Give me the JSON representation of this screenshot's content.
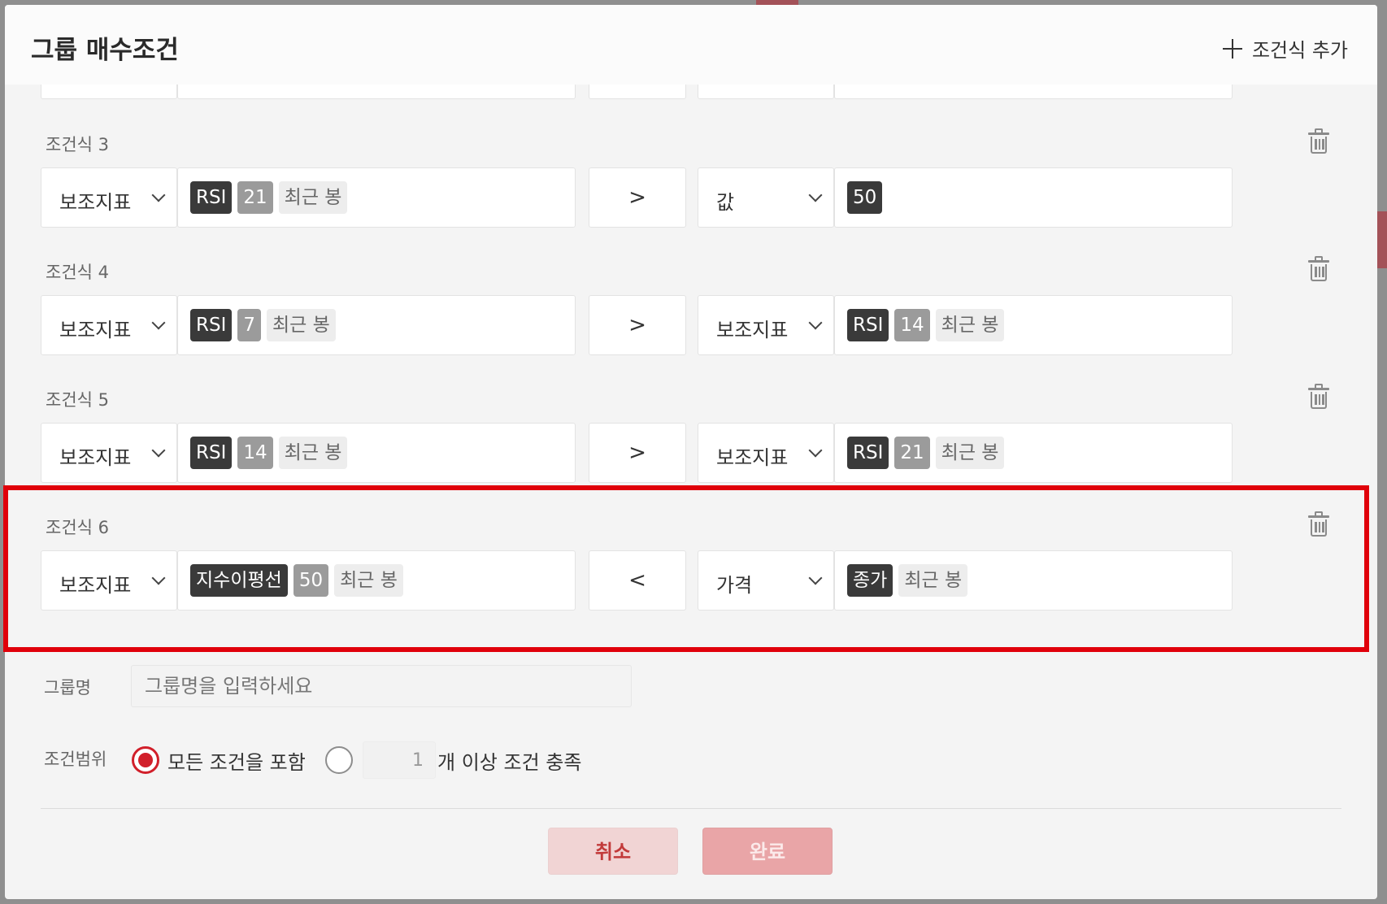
{
  "header": {
    "title": "그룹 매수조건",
    "add_condition_label": "조건식 추가"
  },
  "conditions": [
    {
      "label": "조건식 3",
      "left_type": "보조지표",
      "left_tags": [
        "RSI",
        "21",
        "최근 봉"
      ],
      "operator": ">",
      "right_type": "값",
      "right_tags": [
        "50"
      ]
    },
    {
      "label": "조건식 4",
      "left_type": "보조지표",
      "left_tags": [
        "RSI",
        "7",
        "최근 봉"
      ],
      "operator": ">",
      "right_type": "보조지표",
      "right_tags": [
        "RSI",
        "14",
        "최근 봉"
      ]
    },
    {
      "label": "조건식 5",
      "left_type": "보조지표",
      "left_tags": [
        "RSI",
        "14",
        "최근 봉"
      ],
      "operator": ">",
      "right_type": "보조지표",
      "right_tags": [
        "RSI",
        "21",
        "최근 봉"
      ]
    },
    {
      "label": "조건식 6",
      "left_type": "보조지표",
      "left_tags": [
        "지수이평선",
        "50",
        "최근 봉"
      ],
      "operator": "<",
      "right_type": "가격",
      "right_tags": [
        "종가",
        "최근 봉"
      ]
    }
  ],
  "group_name": {
    "label": "그룹명",
    "placeholder": "그룹명을 입력하세요",
    "value": ""
  },
  "condition_range": {
    "label": "조건범위",
    "all_option_label": "모든 조건을 포함",
    "count_value": "1",
    "count_option_label": "개 이상 조건 충족"
  },
  "footer": {
    "cancel_label": "취소",
    "confirm_label": "완료"
  },
  "colors": {
    "accent_red": "#d11f2a",
    "highlight_border": "#e0000a",
    "tag_dark": "#3a3a3a",
    "tag_mid": "#9b9b9b"
  }
}
